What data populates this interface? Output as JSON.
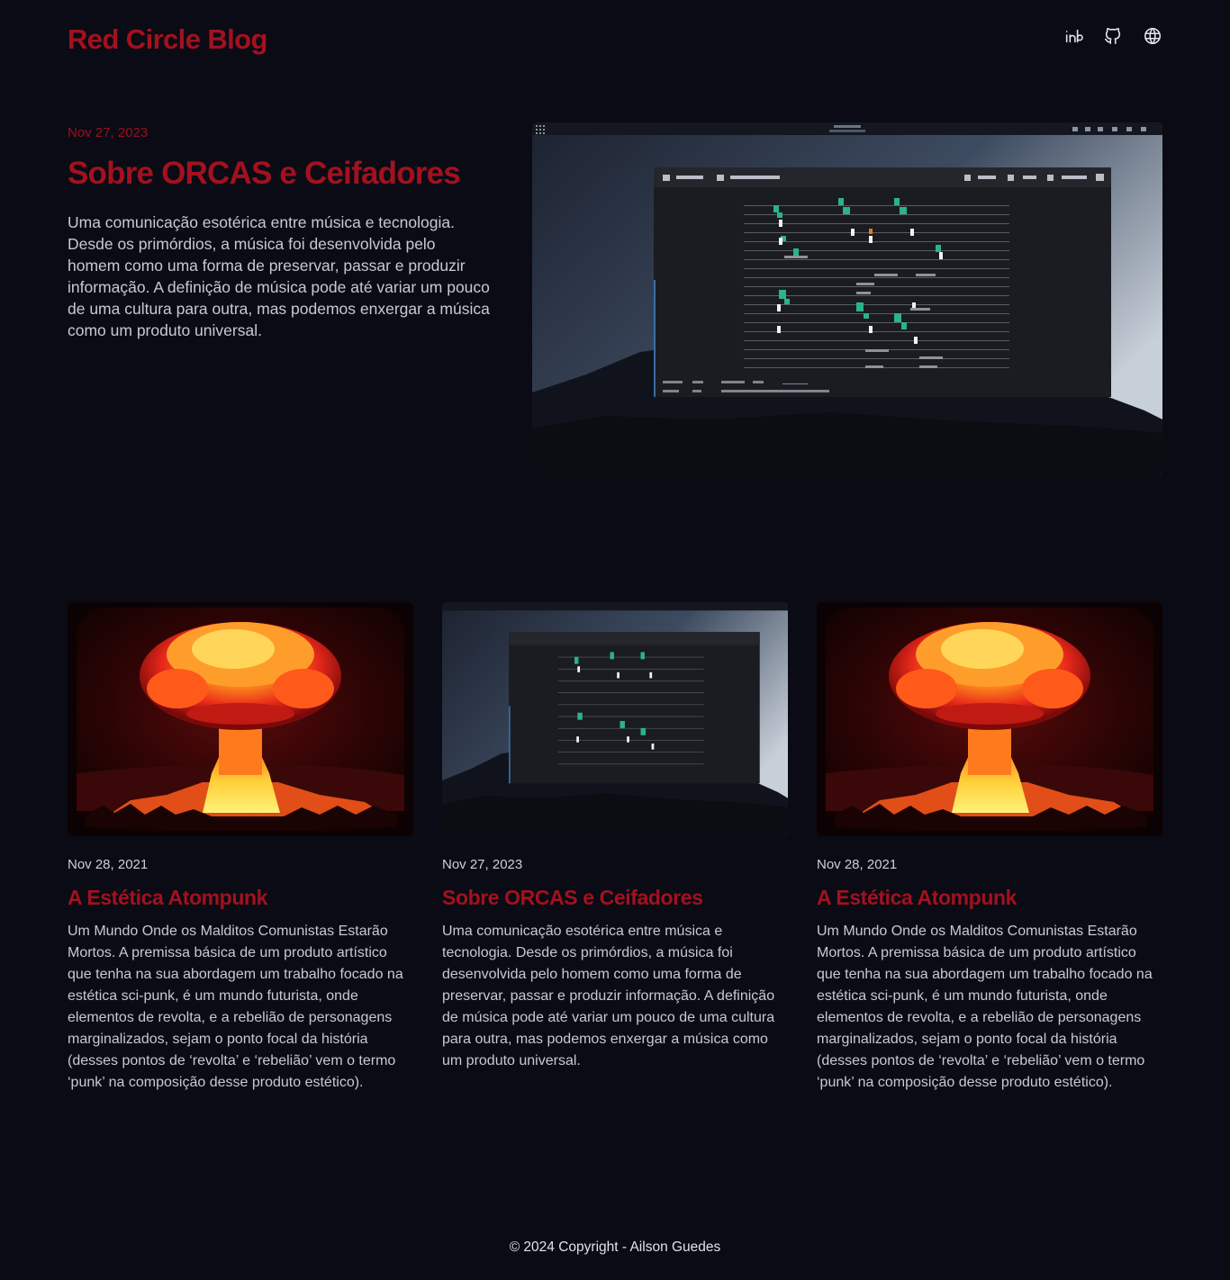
{
  "header": {
    "brand": "Red Circle Blog",
    "social": [
      {
        "name": "linkedin-icon"
      },
      {
        "name": "github-icon"
      },
      {
        "name": "globe-icon"
      }
    ]
  },
  "hero": {
    "date": "Nov 27, 2023",
    "title": "Sobre ORCAS e Ceifadores",
    "description": "Uma comunicação esotérica entre música e tecnologia. Desde os primórdios, a música foi desenvolvida pelo homem como uma forma de preservar, passar e produzir informação. A definição de música pode até variar um pouco de uma cultura para outra, mas podemos enxergar a música como um produto universal."
  },
  "posts": [
    {
      "date": "Nov 28, 2021",
      "title": "A Estética Atompunk",
      "description": "Um Mundo Onde os Malditos Comunistas Estarão Mortos. A premissa básica de um produto artístico que tenha na sua abordagem um trabalho focado na estética sci-punk, é um mundo futurista, onde elementos de revolta, e a rebelião de personagens marginalizados, sejam o ponto focal da história (desses pontos de ‘revolta’ e ‘rebelião’ vem o termo ‘punk’ na composição desse produto estético)."
    },
    {
      "date": "Nov 27, 2023",
      "title": "Sobre ORCAS e Ceifadores",
      "description": "Uma comunicação esotérica entre música e tecnologia. Desde os primórdios, a música foi desenvolvida pelo homem como uma forma de preservar, passar e produzir informação. A definição de música pode até variar um pouco de uma cultura para outra, mas podemos enxergar a música como um produto universal."
    },
    {
      "date": "Nov 28, 2021",
      "title": "A Estética Atompunk",
      "description": "Um Mundo Onde os Malditos Comunistas Estarão Mortos. A premissa básica de um produto artístico que tenha na sua abordagem um trabalho focado na estética sci-punk, é um mundo futurista, onde elementos de revolta, e a rebelião de personagens marginalizados, sejam o ponto focal da história (desses pontos de ‘revolta’ e ‘rebelião’ vem o termo ‘punk’ na composição desse produto estético)."
    }
  ],
  "footer": {
    "copyright": "© 2024 Copyright - Ailson Guedes"
  },
  "colors": {
    "background": "#0a0b14",
    "accent": "#a3111f"
  }
}
